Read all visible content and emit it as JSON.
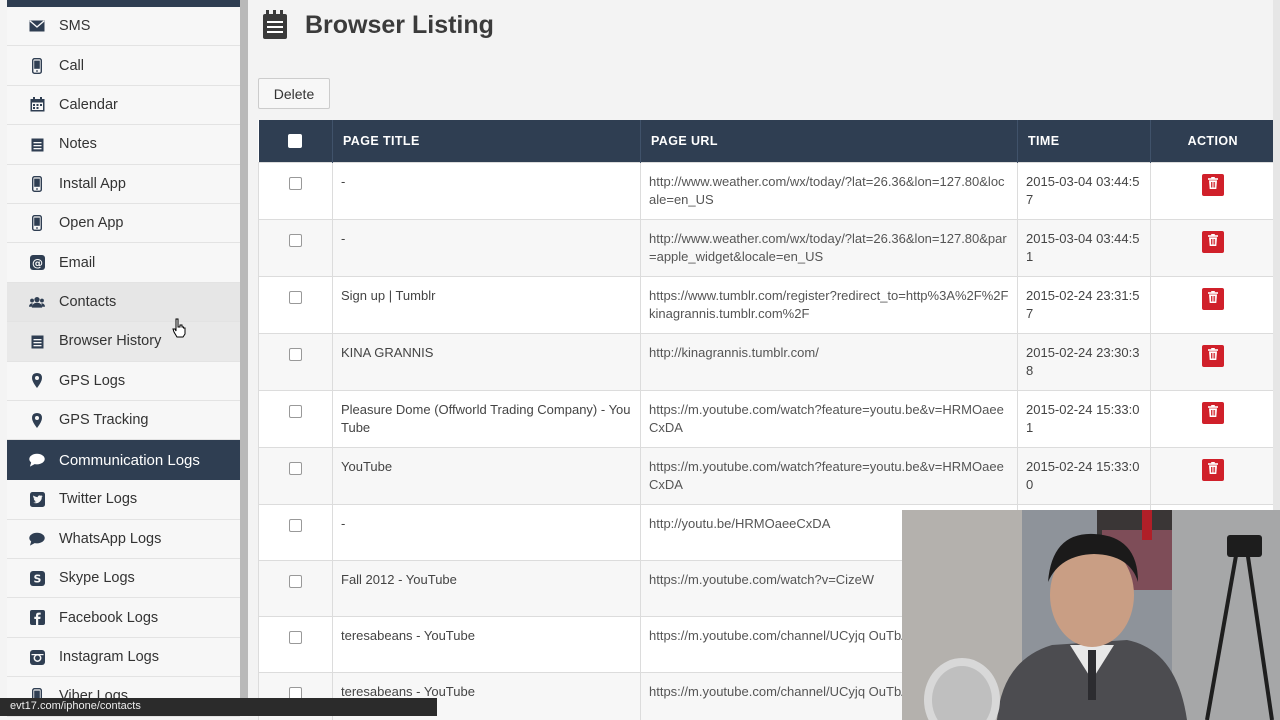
{
  "sidebar": {
    "items": [
      {
        "label": "SMS",
        "icon": "envelope-icon"
      },
      {
        "label": "Call",
        "icon": "phone-icon"
      },
      {
        "label": "Calendar",
        "icon": "calendar-icon"
      },
      {
        "label": "Notes",
        "icon": "notes-icon"
      },
      {
        "label": "Install App",
        "icon": "phone-icon"
      },
      {
        "label": "Open App",
        "icon": "phone-icon"
      },
      {
        "label": "Email",
        "icon": "at-icon"
      },
      {
        "label": "Contacts",
        "icon": "users-icon"
      },
      {
        "label": "Browser History",
        "icon": "notes-icon"
      },
      {
        "label": "GPS Logs",
        "icon": "map-marker-icon"
      },
      {
        "label": "GPS Tracking",
        "icon": "map-marker-icon"
      }
    ],
    "section": {
      "label": "Communication Logs",
      "icon": "chat-bubble-icon"
    },
    "section_items": [
      {
        "label": "Twitter Logs",
        "icon": "twitter-icon"
      },
      {
        "label": "WhatsApp Logs",
        "icon": "chat-bubble-icon"
      },
      {
        "label": "Skype Logs",
        "icon": "skype-icon"
      },
      {
        "label": "Facebook Logs",
        "icon": "facebook-icon"
      },
      {
        "label": "Instagram Logs",
        "icon": "instagram-icon"
      },
      {
        "label": "Viber Logs",
        "icon": "phone-icon"
      }
    ]
  },
  "header": {
    "title": "Browser Listing",
    "icon": "notes-icon"
  },
  "toolbar": {
    "delete_label": "Delete"
  },
  "table": {
    "columns": [
      "PAGE TITLE",
      "PAGE URL",
      "TIME",
      "ACTION"
    ],
    "rows": [
      {
        "title": "-",
        "url": "http://www.weather.com/wx/today/?lat=26.36&lon=127.80&locale=en_US",
        "time": "2015-03-04 03:44:57"
      },
      {
        "title": "-",
        "url": "http://www.weather.com/wx/today/?lat=26.36&lon=127.80&par=apple_widget&locale=en_US",
        "time": "2015-03-04 03:44:51"
      },
      {
        "title": "Sign up | Tumblr",
        "url": "https://www.tumblr.com/register?redirect_to=http%3A%2F%2Fkinagrannis.tumblr.com%2F",
        "time": "2015-02-24 23:31:57"
      },
      {
        "title": "KINA GRANNIS",
        "url": "http://kinagrannis.tumblr.com/",
        "time": "2015-02-24 23:30:38"
      },
      {
        "title": "Pleasure Dome (Offworld Trading Company) - YouTube",
        "url": "https://m.youtube.com/watch?feature=youtu.be&v=HRMOaeeCxDA",
        "time": "2015-02-24 15:33:01"
      },
      {
        "title": "YouTube",
        "url": "https://m.youtube.com/watch?feature=youtu.be&v=HRMOaeeCxDA",
        "time": "2015-02-24 15:33:00"
      },
      {
        "title": "-",
        "url": "http://youtu.be/HRMOaeeCxDA",
        "time": ""
      },
      {
        "title": "Fall 2012 - YouTube",
        "url": "https://m.youtube.com/watch?v=CizeW",
        "time": ""
      },
      {
        "title": "teresabeans - YouTube",
        "url": "https://m.youtube.com/channel/UCyjq OuTbA",
        "time": ""
      },
      {
        "title": "teresabeans - YouTube",
        "url": "https://m.youtube.com/channel/UCyjq OuTbA",
        "time": ""
      }
    ]
  },
  "statusbar": {
    "url": "evt17.com/iphone/contacts"
  },
  "colors": {
    "nav_dark": "#2f3e52",
    "delete_red": "#d0202a"
  }
}
